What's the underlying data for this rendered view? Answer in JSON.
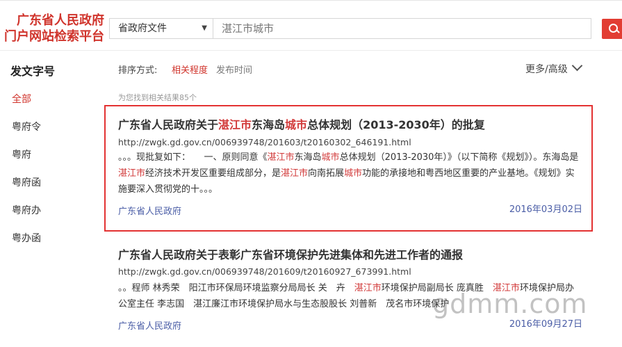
{
  "logo": {
    "line1": "广东省人民政府",
    "line2": "门户网站检索平台"
  },
  "search": {
    "scope": "省政府文件",
    "query": "湛江市城市"
  },
  "sidebar": {
    "title": "发文字号",
    "items": [
      "全部",
      "粤府令",
      "粤府",
      "粤府函",
      "粤府办",
      "粤办函"
    ]
  },
  "sort": {
    "label": "排序方式:",
    "options": [
      "相关程度",
      "发布时间"
    ],
    "active": "相关程度"
  },
  "more": {
    "label": "更多/高级"
  },
  "result_count": "为您找到相关结果85个",
  "results": [
    {
      "title": [
        "广东省人民政府关于",
        "湛江市",
        "东海岛",
        "城市",
        "总体规划（2013-2030年）的批复"
      ],
      "url": "http://zwgk.gd.gov.cn/006939748/201603/t20160302_646191.html",
      "snippet": [
        "。。。现批复如下：　　一、原则同意《",
        "湛江市",
        "东海岛",
        "城市",
        "总体规划（2013-2030年）》（以下简称《规划》）。东海岛是",
        "湛江市",
        "经济技术开发区重要组成部分，是",
        "湛江市",
        "向南拓展",
        "城市",
        "功能的承接地和粤西地区重要的产业基地。《规划》实施要深入贯彻党的十。。。"
      ],
      "source": "广东省人民政府",
      "date": "2016年03月02日"
    },
    {
      "title": [
        "广东省人民政府关于表彰广东省环境保护先进集体和先进工作者的通报"
      ],
      "url": "http://zwgk.gd.gov.cn/006939748/201609/t20160927_673991.html",
      "snippet": [
        "。。程师 林秀荣　阳江市环保局环境监察分局局长 关　卉　",
        "湛江市",
        "环境保护局副局长 庞真胜　",
        "湛江市",
        "环境保护局办公室主任 李志国　湛江廉江市环境保护局水与生态股股长 刘普新　茂名市环境保护"
      ],
      "source": "广东省人民政府",
      "date": "2016年09月27日"
    }
  ],
  "watermark": "gdmm.com"
}
